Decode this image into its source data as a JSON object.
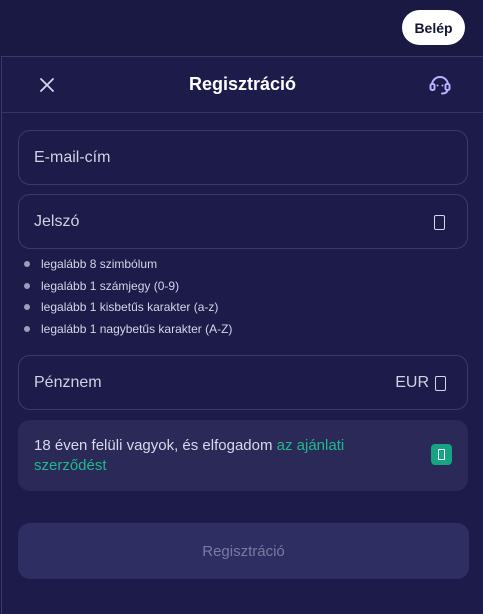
{
  "topbar": {
    "login_label": "Belép"
  },
  "modal": {
    "title": "Regisztráció",
    "fields": {
      "email_label": "E-mail-cím",
      "password_label": "Jelszó",
      "currency_label": "Pénznem",
      "currency_value": "EUR"
    },
    "password_rules": [
      "legalább 8 szimbólum",
      "legalább 1 számjegy (0-9)",
      "legalább 1 kisbetűs karakter (a-z)",
      "legalább 1 nagybetűs karakter (A-Z)"
    ],
    "terms": {
      "text": "18 éven felüli vagyok, és elfogadom ",
      "link": "az ajánlati szerződést",
      "checked": true
    },
    "submit_label": "Regisztráció"
  },
  "icons": {
    "close": "close-icon",
    "support": "headset-icon",
    "password_toggle": "eye-icon",
    "currency_chevron": "chevron-down-icon",
    "checkbox": "check-icon"
  },
  "colors": {
    "background": "#1a1943",
    "panel": "#1c1b4a",
    "terms_background": "#2a2958",
    "accent": "#1fba8a",
    "checkbox": "#16a484",
    "submit_disabled": "#2f2e62"
  }
}
